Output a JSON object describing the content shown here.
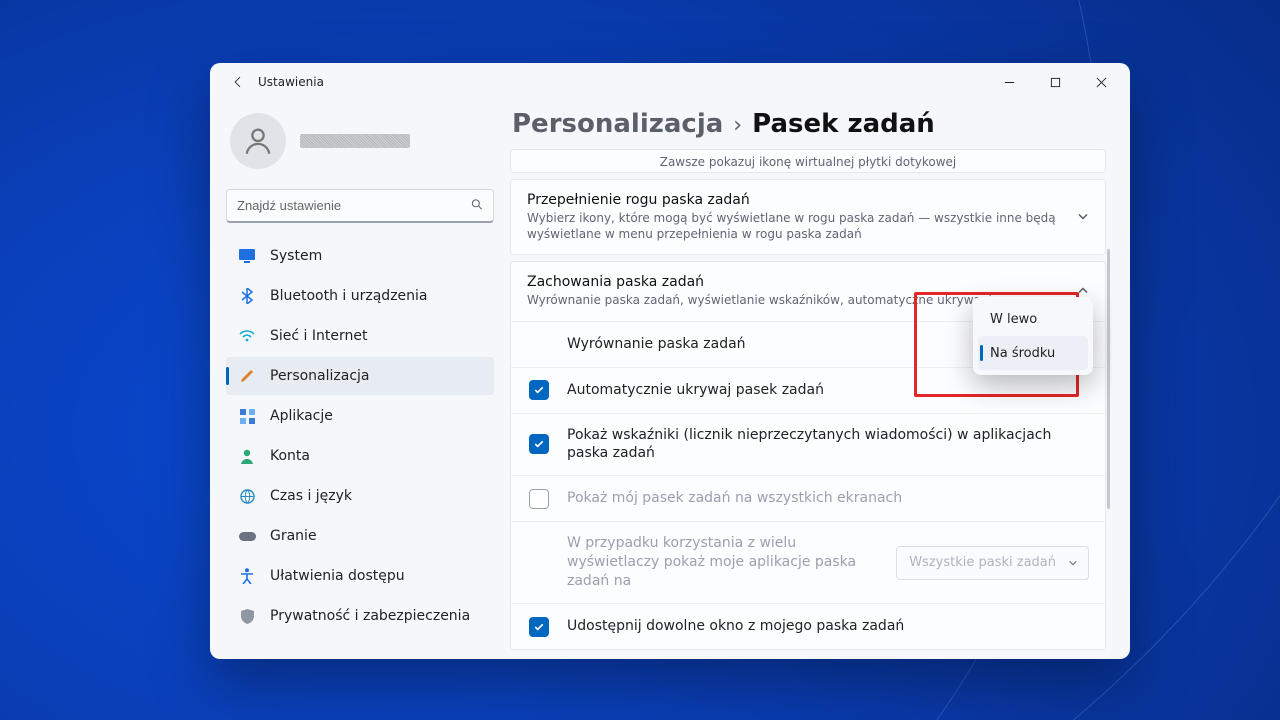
{
  "app_title": "Ustawienia",
  "search_placeholder": "Znajdź ustawienie",
  "sidebar": {
    "items": [
      {
        "label": "System"
      },
      {
        "label": "Bluetooth i urządzenia"
      },
      {
        "label": "Sieć i Internet"
      },
      {
        "label": "Personalizacja"
      },
      {
        "label": "Aplikacje"
      },
      {
        "label": "Konta"
      },
      {
        "label": "Czas i język"
      },
      {
        "label": "Granie"
      },
      {
        "label": "Ułatwienia dostępu"
      },
      {
        "label": "Prywatność i zabezpieczenia"
      }
    ]
  },
  "breadcrumb": {
    "parent": "Personalizacja",
    "current": "Pasek zadań"
  },
  "cards": {
    "clipped_sub": "Zawsze pokazuj ikonę wirtualnej płytki dotykowej",
    "overflow": {
      "title": "Przepełnienie rogu paska zadań",
      "sub": "Wybierz ikony, które mogą być wyświetlane w rogu paska zadań — wszystkie inne będą wyświetlane w menu przepełnienia w rogu paska zadań"
    },
    "behaviors": {
      "title": "Zachowania paska zadań",
      "sub": "Wyrównanie paska zadań, wyświetlanie wskaźników, automatyczne ukrywanie",
      "alignment_label": "Wyrównanie paska zadań",
      "alignment_options": [
        "W lewo",
        "Na środku"
      ],
      "rows": [
        {
          "label": "Automatycznie ukrywaj pasek zadań"
        },
        {
          "label": "Pokaż wskaźniki (licznik nieprzeczytanych wiadomości) w aplikacjach paska zadań"
        },
        {
          "label": "Pokaż mój pasek zadań na wszystkich ekranach"
        },
        {
          "label": "W przypadku korzystania z wielu wyświetlaczy pokaż moje aplikacje paska zadań na"
        },
        {
          "label": "Udostępnij dowolne okno z mojego paska zadań"
        }
      ],
      "multi_display_combo": "Wszystkie paski zadań"
    }
  }
}
